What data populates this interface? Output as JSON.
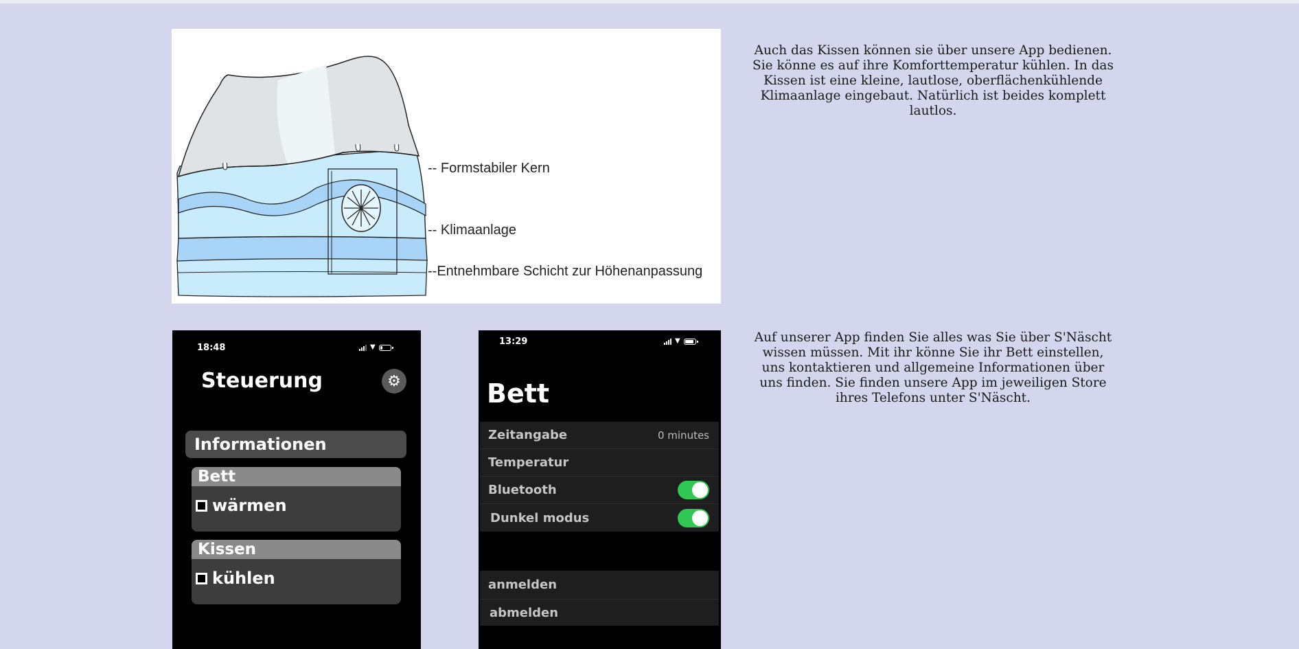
{
  "illustration": {
    "callouts": {
      "core": "-- Formstabiler Kern",
      "climate": "-- Klimaanlage",
      "layer": "--Entnehmbare Schicht zur Höhenanpassung"
    }
  },
  "paragraphs": {
    "pillow": "Auch das Kissen können sie über unsere App bedienen. Sie könne es auf ihre Komforttemperatur kühlen. In das Kissen ist eine kleine, lautlose, oberflächenkühlende Klimaanlage eingebaut. Natürlich ist beides komplett lautlos.",
    "app": "Auf unserer App finden Sie alles was Sie über S'Näscht wissen müssen. Mit ihr könne Sie ihr Bett einstellen, uns kontaktieren und allgemeine Informationen über uns finden. Sie finden unsere App im jeweiligen Store ihres Telefons unter S'Näscht."
  },
  "phone_control": {
    "time": "18:48",
    "title": "Steuerung",
    "settings_icon": "gear-icon",
    "info_button": "Informationen",
    "bed_card": {
      "header": "Bett",
      "option": "wärmen",
      "checked": false
    },
    "pillow_card": {
      "header": "Kissen",
      "option": "kühlen",
      "checked": false
    }
  },
  "phone_bed": {
    "time": "13:29",
    "title": "Bett",
    "settings": [
      {
        "label": "Zeitangabe",
        "value": "0 minutes"
      },
      {
        "label": "Temperatur",
        "value": ""
      },
      {
        "label": "Bluetooth",
        "toggle": true
      },
      {
        "label": "Dunkel modus",
        "toggle": true
      }
    ],
    "account": {
      "login": "anmelden",
      "logout": "abmelden"
    }
  },
  "colors": {
    "page_background": "#d4d6ee",
    "toggle_on": "#30c852",
    "pillow_blue": "#c8ecfc",
    "pillow_band": "#a8d4f8"
  }
}
